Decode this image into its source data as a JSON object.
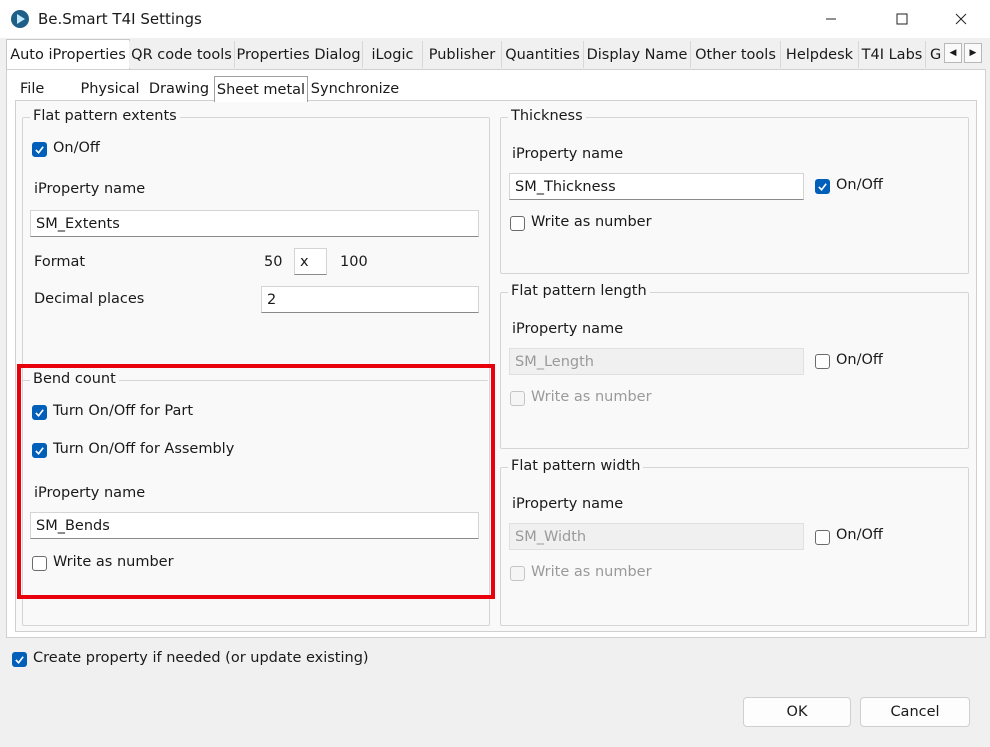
{
  "window": {
    "title": "Be.Smart T4I Settings"
  },
  "tabs": [
    {
      "label": "Auto iProperties",
      "active": true
    },
    {
      "label": "QR code tools"
    },
    {
      "label": "Properties Dialog"
    },
    {
      "label": "iLogic"
    },
    {
      "label": "Publisher"
    },
    {
      "label": "Quantities"
    },
    {
      "label": "Display Name"
    },
    {
      "label": "Other tools"
    },
    {
      "label": "Helpdesk"
    },
    {
      "label": "T4I Labs"
    },
    {
      "label": "G"
    }
  ],
  "subtabs": [
    {
      "label": "File"
    },
    {
      "label": "Physical"
    },
    {
      "label": "Drawing"
    },
    {
      "label": "Sheet metal",
      "active": true
    },
    {
      "label": "Synchronize"
    }
  ],
  "flat_extents": {
    "title": "Flat pattern extents",
    "onoff_label": "On/Off",
    "onoff_checked": true,
    "iprop_label": "iProperty name",
    "iprop_value": "SM_Extents",
    "format_label": "Format",
    "format_w": "50",
    "format_sep": "x",
    "format_h": "100",
    "decimal_label": "Decimal places",
    "decimal_value": "2"
  },
  "bend_count": {
    "title": "Bend count",
    "part_label": "Turn On/Off for Part",
    "part_checked": true,
    "assembly_label": "Turn On/Off for Assembly",
    "assembly_checked": true,
    "iprop_label": "iProperty name",
    "iprop_value": "SM_Bends",
    "write_number_label": "Write as number",
    "write_number_checked": false
  },
  "thickness": {
    "title": "Thickness",
    "iprop_label": "iProperty name",
    "iprop_value": "SM_Thickness",
    "onoff_label": "On/Off",
    "onoff_checked": true,
    "write_number_label": "Write as number",
    "write_number_checked": false
  },
  "flat_length": {
    "title": "Flat pattern length",
    "iprop_label": "iProperty name",
    "iprop_value": "SM_Length",
    "onoff_label": "On/Off",
    "onoff_checked": false,
    "write_number_label": "Write as number",
    "write_number_checked": false
  },
  "flat_width": {
    "title": "Flat pattern width",
    "iprop_label": "iProperty name",
    "iprop_value": "SM_Width",
    "onoff_label": "On/Off",
    "onoff_checked": false,
    "write_number_label": "Write as number",
    "write_number_checked": false
  },
  "footer": {
    "create_label": "Create property if needed (or update existing)",
    "create_checked": true,
    "ok_label": "OK",
    "cancel_label": "Cancel"
  },
  "colors": {
    "accent": "#005fb8",
    "highlight": "#e8000c"
  }
}
